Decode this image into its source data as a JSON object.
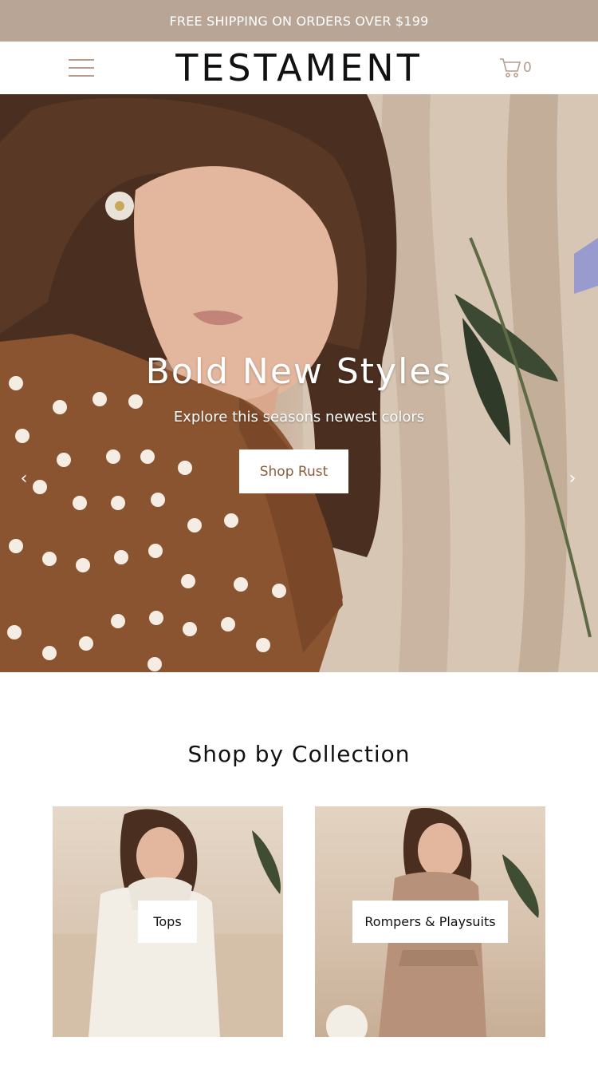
{
  "announcement": {
    "text": "FREE SHIPPING ON ORDERS OVER $199"
  },
  "header": {
    "logo": "TESTAMENT",
    "cart_count": "0"
  },
  "hero": {
    "title": "Bold New Styles",
    "subtitle": "Explore this seasons newest colors",
    "button_label": "Shop Rust"
  },
  "collections": {
    "title": "Shop by Collection",
    "items": [
      {
        "label": "Tops"
      },
      {
        "label": "Rompers & Playsuits"
      }
    ]
  },
  "colors": {
    "accent": "#b9a595",
    "rust": "#8a5d3e"
  },
  "icons": [
    "menu-icon",
    "cart-icon",
    "chevron-left-icon",
    "chevron-right-icon"
  ]
}
